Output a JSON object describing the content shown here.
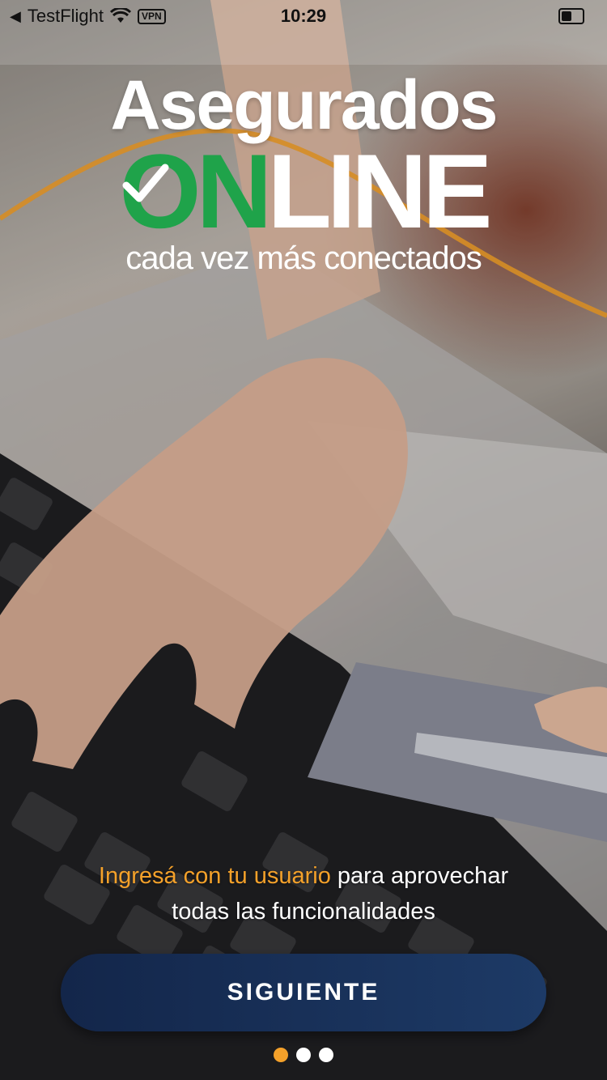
{
  "status_bar": {
    "back_app": "TestFlight",
    "vpn": "VPN",
    "time": "10:29",
    "icons": [
      "back-arrow-icon",
      "wifi-icon",
      "battery-icon"
    ]
  },
  "logo": {
    "title": "Asegurados",
    "online_prefix": "ON",
    "online_suffix": "LINE",
    "tagline": "cada vez más conectados"
  },
  "message": {
    "highlight": "Ingresá con tu usuario",
    "rest_line1": " para aprovechar",
    "line2": "todas las funcionalidades"
  },
  "button": {
    "label": "SIGUIENTE"
  },
  "pager": {
    "pages": 3,
    "active_index": 0
  },
  "colors": {
    "accent_orange": "#f4a12a",
    "brand_green": "#1fa34a",
    "button_navy": "#13264a"
  }
}
